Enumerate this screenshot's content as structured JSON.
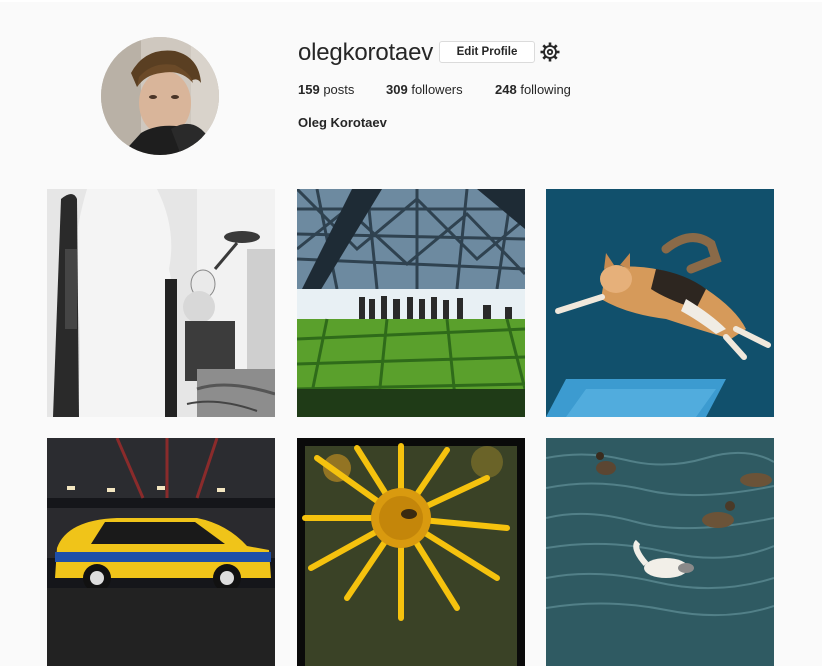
{
  "profile": {
    "username": "olegkorotaev",
    "edit_label": "Edit Profile",
    "full_name": "Oleg Korotaev",
    "stats": [
      {
        "count": "159",
        "label": "posts"
      },
      {
        "count": "309",
        "label": "followers"
      },
      {
        "count": "248",
        "label": "following"
      }
    ]
  },
  "posts": [
    {
      "subject": "mannequin-workshop-bw"
    },
    {
      "subject": "glass-canopy-park-crowd"
    },
    {
      "subject": "calico-cat-jumping"
    },
    {
      "subject": "police-volga-car"
    },
    {
      "subject": "yellow-flower-bee"
    },
    {
      "subject": "ducks-on-water"
    }
  ],
  "icons": {
    "settings": "gear-icon"
  },
  "colors": {
    "background": "#fafafa",
    "text": "#262626",
    "button_border": "#dbdbdb"
  }
}
